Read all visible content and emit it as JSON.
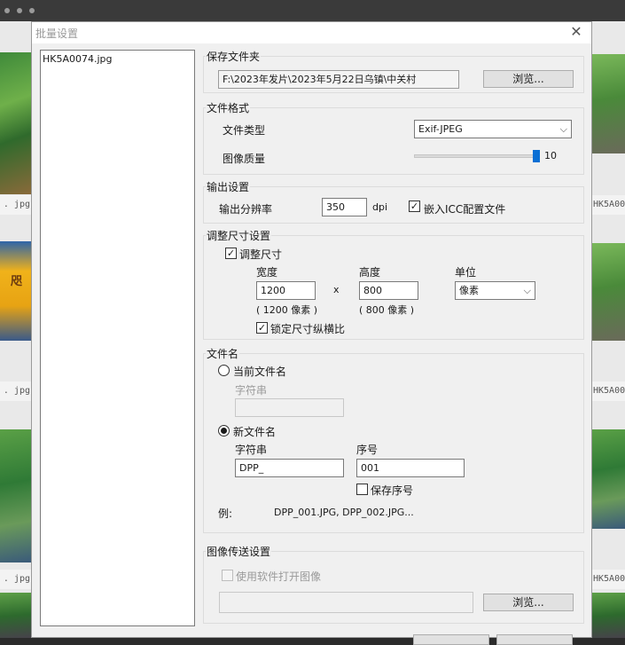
{
  "background": {
    "left_captions": [
      ". jpg",
      ". jpg",
      ". jpg"
    ],
    "right_captions": [
      "HK5A00",
      "HK5A00",
      "HK5A00"
    ],
    "thumb_banner_text": "咫"
  },
  "dialog": {
    "title": "批量设置",
    "close_glyph": "✕",
    "file_list": [
      "HK5A0074.jpg"
    ],
    "save_folder": {
      "label": "保存文件夹",
      "path": "F:\\2023年发片\\2023年5月22日乌镇\\中关村",
      "browse": "浏览..."
    },
    "file_format": {
      "label": "文件格式",
      "type_label": "文件类型",
      "type_value": "Exif-JPEG",
      "quality_label": "图像质量",
      "quality_value": "10",
      "quality_fraction": 0.97
    },
    "output": {
      "label": "输出设置",
      "resolution_label": "输出分辨率",
      "resolution_value": "350",
      "resolution_unit": "dpi",
      "embed_icc_label": "嵌入ICC配置文件",
      "embed_icc_checked": true
    },
    "resize": {
      "label": "调整尺寸设置",
      "enable_label": "调整尺寸",
      "enable_checked": true,
      "width_label": "宽度",
      "width_value": "1200",
      "width_hint": "( 1200 像素 )",
      "times": "x",
      "height_label": "高度",
      "height_value": "800",
      "height_hint": "( 800 像素 )",
      "unit_label": "单位",
      "unit_value": "像素",
      "lock_label": "锁定尺寸纵横比",
      "lock_checked": true
    },
    "filename": {
      "label": "文件名",
      "current_label": "当前文件名",
      "current_string_label": "字符串",
      "current_string_value": "",
      "new_label": "新文件名",
      "new_selected": true,
      "new_string_label": "字符串",
      "new_string_value": "DPP_",
      "serial_label": "序号",
      "serial_value": "001",
      "keep_serial_label": "保存序号",
      "keep_serial_checked": false,
      "example_label": "例:",
      "example_value": "DPP_001.JPG, DPP_002.JPG..."
    },
    "transfer": {
      "label": "图像传送设置",
      "open_with_label": "使用软件打开图像",
      "open_with_checked": false,
      "path_value": "",
      "browse": "浏览..."
    }
  }
}
